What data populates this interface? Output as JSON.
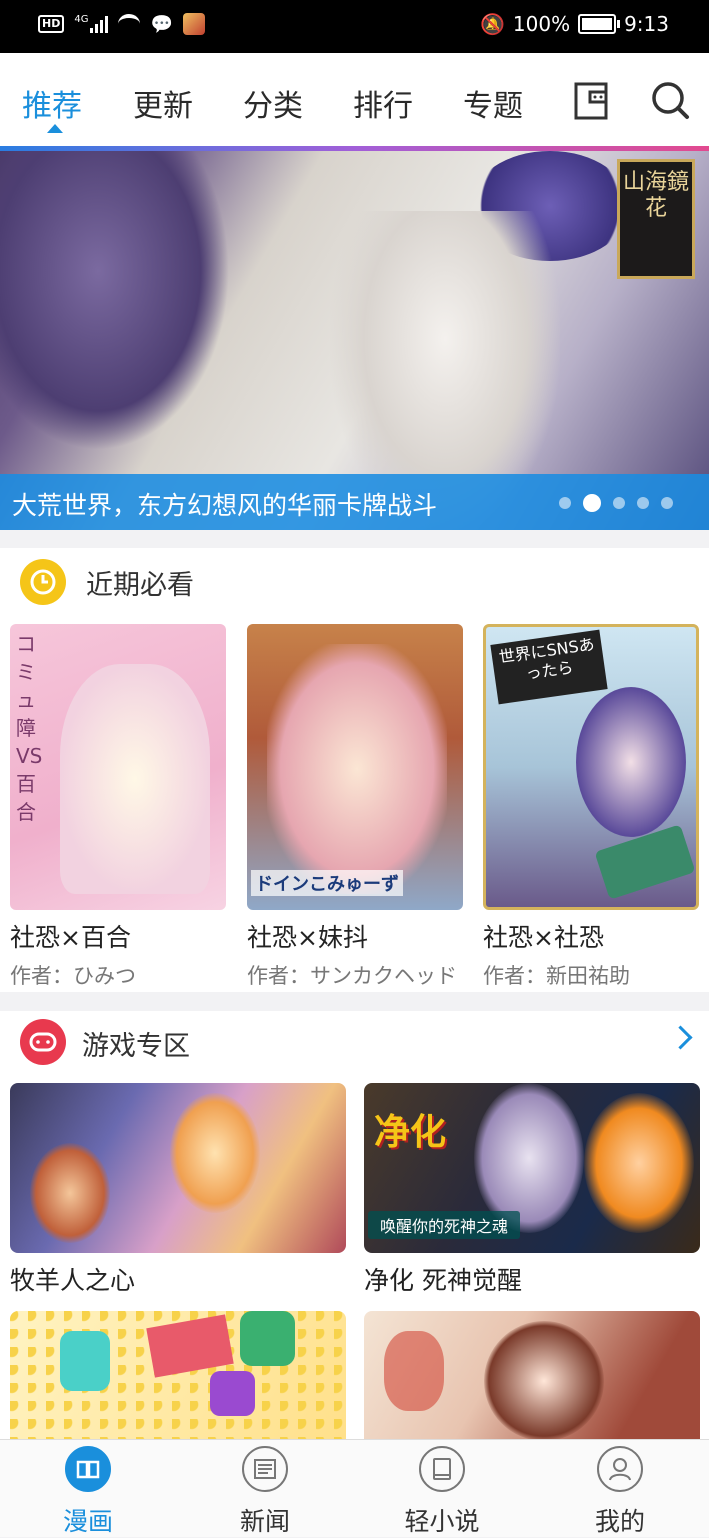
{
  "status_bar": {
    "hd": "HD",
    "network": "4G",
    "battery": "100%",
    "time": "9:13"
  },
  "tabs": [
    {
      "label": "推荐",
      "active": true
    },
    {
      "label": "更新",
      "active": false
    },
    {
      "label": "分类",
      "active": false
    },
    {
      "label": "排行",
      "active": false
    },
    {
      "label": "专题",
      "active": false
    }
  ],
  "top_icons": [
    "message-icon",
    "search-icon"
  ],
  "banner": {
    "caption": "大荒世界，东方幻想风的华丽卡牌战斗",
    "seal_text": "山海鏡花",
    "page_count": 5,
    "active_page": 2
  },
  "section_recommend": {
    "title": "近期必看",
    "icon_color": "#f5c518",
    "items": [
      {
        "title": "社恐×百合",
        "author": "作者：ひみつ",
        "cover_text": "コミュ障VS百合"
      },
      {
        "title": "社恐×妹抖",
        "author": "作者：サンカクヘッド",
        "cover_text": "ドインこみゅーず"
      },
      {
        "title": "社恐×社恐",
        "author": "作者：新田祐助",
        "cover_text": "世界にSNSあったら"
      }
    ]
  },
  "section_games": {
    "title": "游戏专区",
    "icon_color": "#e8394e",
    "items": [
      {
        "title": "牧羊人之心"
      },
      {
        "title": "净化 死神觉醒",
        "overlay_title": "净化",
        "overlay_subtitle": "唤醒你的死神之魂"
      },
      {
        "title": ""
      },
      {
        "title": ""
      }
    ]
  },
  "bottom_nav": [
    {
      "label": "漫画",
      "active": true,
      "icon": "comic-book-icon"
    },
    {
      "label": "新闻",
      "active": false,
      "icon": "news-icon"
    },
    {
      "label": "轻小说",
      "active": false,
      "icon": "novel-icon"
    },
    {
      "label": "我的",
      "active": false,
      "icon": "profile-icon"
    }
  ],
  "colors": {
    "accent": "#1a8fdc"
  }
}
